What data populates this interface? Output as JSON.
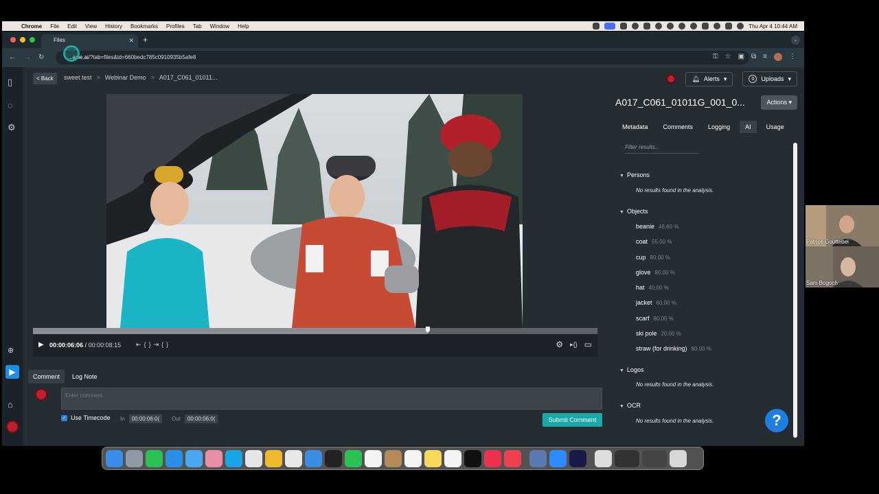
{
  "menubar": {
    "items": [
      "Chrome",
      "File",
      "Edit",
      "View",
      "History",
      "Bookmarks",
      "Profiles",
      "Tab",
      "Window",
      "Help"
    ],
    "clock": "Thu Apr 4  10:44 AM"
  },
  "browser": {
    "tab_title": "Files",
    "url_host": "...axie.ai",
    "url_rest": "/?tab=files&id=660bedc785c0910935b5afe8"
  },
  "header": {
    "back_label": "< Back",
    "breadcrumb": [
      "sweet test",
      "Webinar Demo",
      "A017_C061_01011..."
    ],
    "alerts_label": "Alerts",
    "uploads_count": "0",
    "uploads_label": "Uploads"
  },
  "player": {
    "current_time": "00:00:06:06",
    "separator": "/",
    "duration": "00:00:08:15",
    "progress": 0.7
  },
  "comment": {
    "tabs": [
      "Comment",
      "Log Note"
    ],
    "placeholder": "Enter comment",
    "use_timecode_label": "Use Timecode",
    "in_label": "In",
    "in_value": "00:00:06:0(",
    "out_label": "Out",
    "out_value": "00:00:06:0(",
    "submit_label": "Submit Comment"
  },
  "panel": {
    "title": "A017_C061_01011G_001_0...",
    "actions_label": "Actions",
    "tabs": [
      "Metadata",
      "Comments",
      "Logging",
      "AI",
      "Usage"
    ],
    "active_tab": "AI",
    "filter_placeholder": "Filter results...",
    "persons_label": "Persons",
    "no_results": "No results found in the analysis.",
    "objects_label": "Objects",
    "objects": [
      {
        "name": "beanie",
        "pct": "46.60 %"
      },
      {
        "name": "coat",
        "pct": "55.00 %"
      },
      {
        "name": "cup",
        "pct": "80.00 %"
      },
      {
        "name": "glove",
        "pct": "80.00 %"
      },
      {
        "name": "hat",
        "pct": "40.00 %"
      },
      {
        "name": "jacket",
        "pct": "60.00 %"
      },
      {
        "name": "scarf",
        "pct": "80.00 %"
      },
      {
        "name": "ski pole",
        "pct": "20.00 %"
      },
      {
        "name": "straw (for drinking)",
        "pct": "80.00 %"
      }
    ],
    "logos_label": "Logos",
    "ocr_label": "OCR"
  },
  "help_label": "?",
  "call": {
    "participants": [
      "Patrice Gouttebel",
      "Sam Bogoch"
    ]
  },
  "colors": {
    "accent_teal": "#1aa9a7",
    "brand_red": "#c0202e",
    "app_bg": "#252d33"
  }
}
